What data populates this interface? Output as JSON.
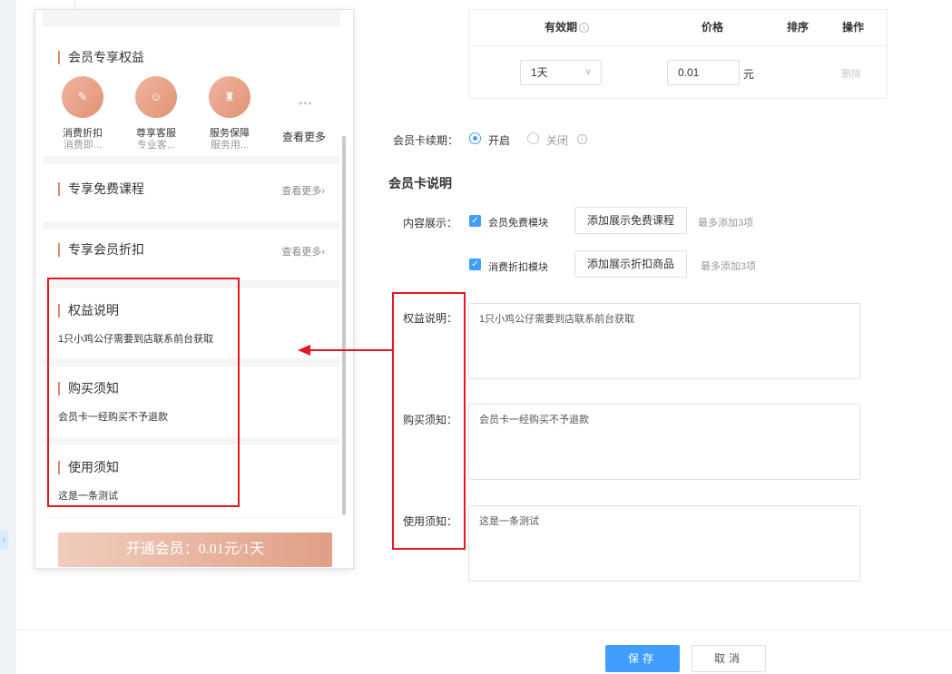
{
  "preview": {
    "benefits_title": "会员专享权益",
    "benefits": [
      {
        "name": "消费折扣",
        "desc": "消费即...",
        "icon": "tag-icon"
      },
      {
        "name": "尊享客服",
        "desc": "专业客...",
        "icon": "support-icon"
      },
      {
        "name": "服务保障",
        "desc": "服务用...",
        "icon": "shield-icon"
      }
    ],
    "dots": "•••",
    "benefits_more": "查看更多",
    "free_course_title": "专享免费课程",
    "free_course_more": "查看更多›",
    "discount_title": "专享会员折扣",
    "discount_more": "查看更多›",
    "rights_title": "权益说明",
    "rights_text": "1只小鸡公仔需要到店联系前台获取",
    "purchase_title": "购买须知",
    "purchase_text": "会员卡一经购买不予退款",
    "usage_title": "使用须知",
    "usage_text": "这是一条测试",
    "open_button": "开通会员：0.01元/1天"
  },
  "price_table": {
    "headers": [
      "有效期",
      "价格",
      "排序",
      "操作"
    ],
    "info_icon": "i",
    "row": {
      "period": "1天",
      "price": "0.01",
      "unit": "元",
      "action": "删除"
    }
  },
  "renewal": {
    "label": "会员卡续期：",
    "on_label": "开启",
    "off_label": "关闭",
    "selected": "开启"
  },
  "description": {
    "heading": "会员卡说明",
    "display_label": "内容展示：",
    "modules": [
      {
        "checkbox_label": "会员免费模块",
        "button": "添加展示免费课程",
        "hint": "最多添加3项",
        "checked": true
      },
      {
        "checkbox_label": "消费折扣模块",
        "button": "添加展示折扣商品",
        "hint": "最多添加3项",
        "checked": true
      }
    ],
    "rights_label": "权益说明：",
    "rights_value": "1只小鸡公仔需要到店联系前台获取",
    "purchase_label": "购买须知：",
    "purchase_value": "会员卡一经购买不予退款",
    "usage_label": "使用须知：",
    "usage_value": "这是一条测试"
  },
  "footer": {
    "save": "保存",
    "cancel": "取消"
  },
  "colors": {
    "primary": "#409eff",
    "accent": "#e08a6e",
    "annotation": "#e8161e"
  }
}
